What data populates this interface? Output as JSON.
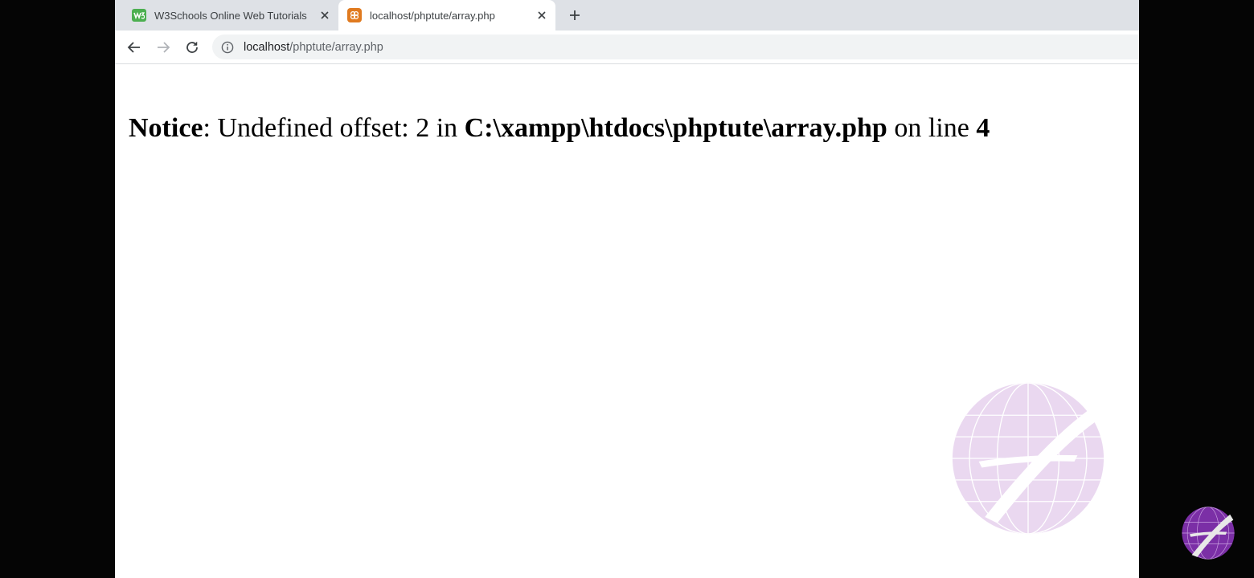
{
  "tabs": [
    {
      "title": "W3Schools Online Web Tutorials",
      "favicon": "w3schools-icon",
      "active": false
    },
    {
      "title": "localhost/phptute/array.php",
      "favicon": "xampp-icon",
      "active": true
    }
  ],
  "toolbar": {
    "url_host": "localhost",
    "url_path": "/phptute/array.php"
  },
  "notice": {
    "label": "Notice",
    "sep": ": ",
    "message": "Undefined offset: 2 in ",
    "file": "C:\\xampp\\htdocs\\phptute\\array.php",
    "on_line": " on line ",
    "line": "4"
  },
  "colors": {
    "tabstrip": "#dee1e6",
    "omnibox": "#f1f3f4",
    "watermark": "#c9a0d8",
    "logo": "#7b2fa6"
  }
}
